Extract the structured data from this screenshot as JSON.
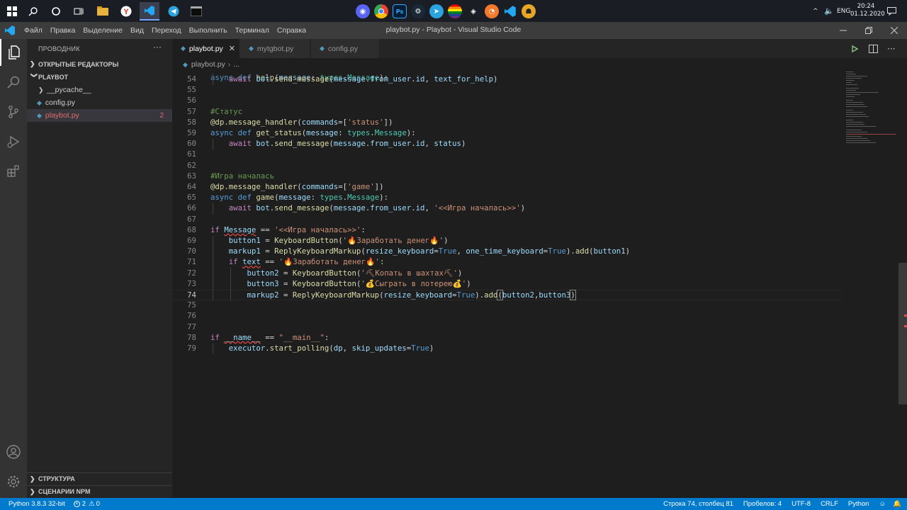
{
  "taskbar": {
    "apps_left": [
      "windows-start-icon",
      "search-icon",
      "cortana-icon",
      "task-view-icon",
      "file-explorer-icon",
      "yandex-browser-icon",
      "vscode-icon",
      "telegram-icon",
      "terminal-icon"
    ],
    "apps_center": [
      "discord-icon",
      "chrome-icon",
      "photoshop-icon",
      "steam-icon",
      "telegram-icon",
      "lgbt-app-icon",
      "unity-icon",
      "blender-icon",
      "vscode-icon",
      "csgo-icon"
    ],
    "lang": "ENG",
    "time": "20:24",
    "date": "01.12.2020"
  },
  "titlebar": {
    "menu": [
      "Файл",
      "Правка",
      "Выделение",
      "Вид",
      "Переход",
      "Выполнить",
      "Терминал",
      "Справка"
    ],
    "title": "playbot.py - Playbot - Visual Studio Code"
  },
  "sidebar": {
    "header": "ПРОВОДНИК",
    "open_editors": "ОТКРЫТЫЕ РЕДАКТОРЫ",
    "project": "PLAYBOT",
    "items": [
      {
        "label": "__pycache__",
        "type": "folder"
      },
      {
        "label": "config.py",
        "type": "py"
      },
      {
        "label": "playbot.py",
        "type": "py",
        "badge": "2"
      }
    ],
    "outline": "СТРУКТУРА",
    "npm": "СЦЕНАРИИ NPM"
  },
  "tabs": [
    {
      "label": "playbot.py",
      "active": true
    },
    {
      "label": "mytgbot.py",
      "active": false
    },
    {
      "label": "config.py",
      "active": false
    }
  ],
  "breadcrumb": {
    "file": "playbot.py",
    "more": "..."
  },
  "code": {
    "partial_top": "async def help(message: types.Message):",
    "lines": [
      {
        "n": "54",
        "text": "    await bot.send_message(message.from_user.id, text_for_help)"
      },
      {
        "n": "55",
        "text": ""
      },
      {
        "n": "56",
        "text": ""
      },
      {
        "n": "57",
        "text": "#Статус"
      },
      {
        "n": "58",
        "text": "@dp.message_handler(commands=['status'])"
      },
      {
        "n": "59",
        "text": "async def get_status(message: types.Message):"
      },
      {
        "n": "60",
        "text": "    await bot.send_message(message.from_user.id, status)"
      },
      {
        "n": "61",
        "text": ""
      },
      {
        "n": "62",
        "text": ""
      },
      {
        "n": "63",
        "text": "#Игра началась"
      },
      {
        "n": "64",
        "text": "@dp.message_handler(commands=['game'])"
      },
      {
        "n": "65",
        "text": "async def game(message: types.Message):"
      },
      {
        "n": "66",
        "text": "    await bot.send_message(message.from_user.id, '<<Игра началась>>')"
      },
      {
        "n": "67",
        "text": ""
      },
      {
        "n": "68",
        "text": "if Message == '<<Игра началась>>':"
      },
      {
        "n": "69",
        "text": "    button1 = KeyboardButton('🔥Заработать денег🔥')"
      },
      {
        "n": "70",
        "text": "    markup1 = ReplyKeyboardMarkup(resize_keyboard=True, one_time_keyboard=True).add(button1)"
      },
      {
        "n": "71",
        "text": "    if text == '🔥Заработать денег🔥':"
      },
      {
        "n": "72",
        "text": "        button2 = KeyboardButton('⛏Копать в шахтах⛏')"
      },
      {
        "n": "73",
        "text": "        button3 = KeyboardButton('💰Сыграть в лотерею💰')"
      },
      {
        "n": "74",
        "text": "        markup2 = ReplyKeyboardMarkup(resize_keyboard=True).add(button2,button3)"
      },
      {
        "n": "75",
        "text": ""
      },
      {
        "n": "76",
        "text": ""
      },
      {
        "n": "77",
        "text": ""
      },
      {
        "n": "78",
        "text": "if __name__ == \"__main__\":"
      },
      {
        "n": "79",
        "text": "    executor.start_polling(dp, skip_updates=True)"
      }
    ]
  },
  "statusbar": {
    "python": "Python 3.8.3 32-bit",
    "errors": "2",
    "warnings": "0",
    "position": "Строка 74, столбец 81",
    "spaces": "Пробелов: 4",
    "encoding": "UTF-8",
    "eol": "CRLF",
    "language": "Python"
  },
  "colors": {
    "accent": "#007acc",
    "editor_bg": "#1e1e1e",
    "sidebar_bg": "#252526"
  }
}
